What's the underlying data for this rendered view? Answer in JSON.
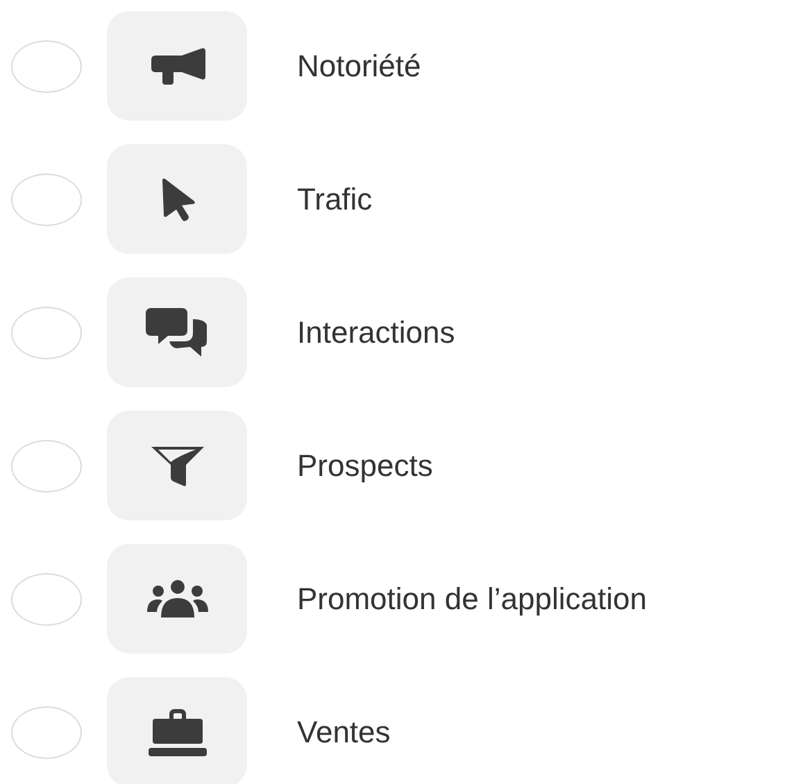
{
  "options": [
    {
      "label": "Notoriété",
      "selected": false
    },
    {
      "label": "Trafic",
      "selected": false
    },
    {
      "label": "Interactions",
      "selected": false
    },
    {
      "label": "Prospects",
      "selected": false
    },
    {
      "label": "Promotion de l’application",
      "selected": false
    },
    {
      "label": "Ventes",
      "selected": false
    }
  ]
}
